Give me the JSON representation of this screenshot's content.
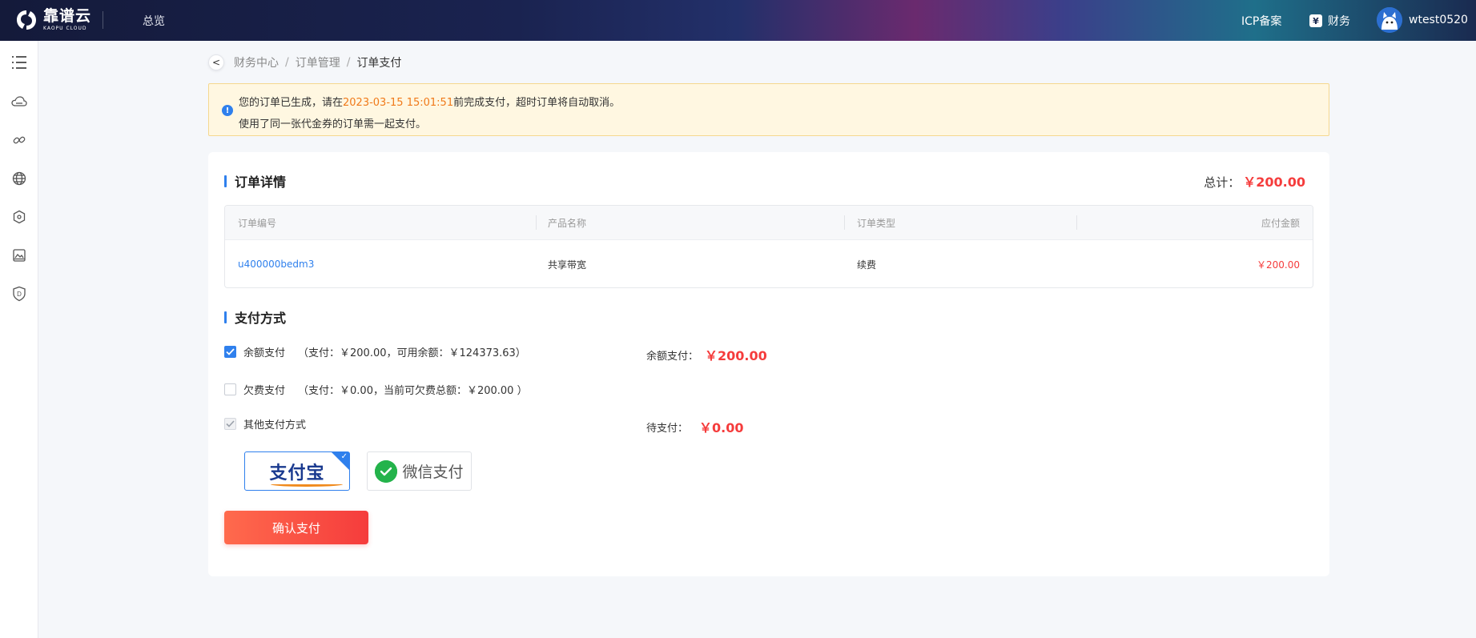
{
  "header": {
    "logo_cn": "靠谱云",
    "logo_en": "KAOPU CLOUD",
    "nav_overview": "总览",
    "icp": "ICP备案",
    "finance": "财务",
    "username": "wtest0520"
  },
  "sidebar": {
    "items": [
      "menu-icon",
      "cloud-icon",
      "link-icon",
      "globe-icon",
      "network-icon",
      "storage-icon",
      "shield-icon"
    ]
  },
  "breadcrumb": {
    "back": "<",
    "items": [
      "财务中心",
      "订单管理",
      "订单支付"
    ],
    "sep": "/"
  },
  "notice": {
    "icon": "!",
    "line1_prefix": "您的订单已生成，请在",
    "deadline": "2023-03-15 15:01:51",
    "line1_suffix": "前完成支付，超时订单将自动取消。",
    "line2": "使用了同一张代金券的订单需一起支付。"
  },
  "order": {
    "title": "订单详情",
    "total_label": "总计：",
    "total_value": "￥200.00",
    "columns": [
      "订单编号",
      "产品名称",
      "订单类型",
      "应付金额"
    ],
    "rows": [
      {
        "order_id": "u400000bedm3",
        "product": "共享带宽",
        "type": "续费",
        "amount": "￥200.00"
      }
    ]
  },
  "payment": {
    "title": "支付方式",
    "balance": {
      "label": "余额支付",
      "detail": "（支付：￥200.00，可用余额：￥124373.63）",
      "checked": true
    },
    "credit": {
      "label": "欠费支付",
      "detail": "（支付：￥0.00，当前可欠费总额：￥200.00 ）",
      "checked": false
    },
    "other": {
      "label": "其他支付方式",
      "checked": true
    },
    "balance_pay_label": "余额支付：",
    "balance_pay_value": "￥200.00",
    "pending_label": "待支付：",
    "pending_value": "￥0.00",
    "methods": [
      {
        "name": "支付宝",
        "selected": true
      },
      {
        "name": "微信支付",
        "selected": false
      }
    ],
    "confirm": "确认支付"
  },
  "colors": {
    "accent": "#2f80ed",
    "price": "#f53c3c",
    "deadline": "#f07a1a"
  }
}
